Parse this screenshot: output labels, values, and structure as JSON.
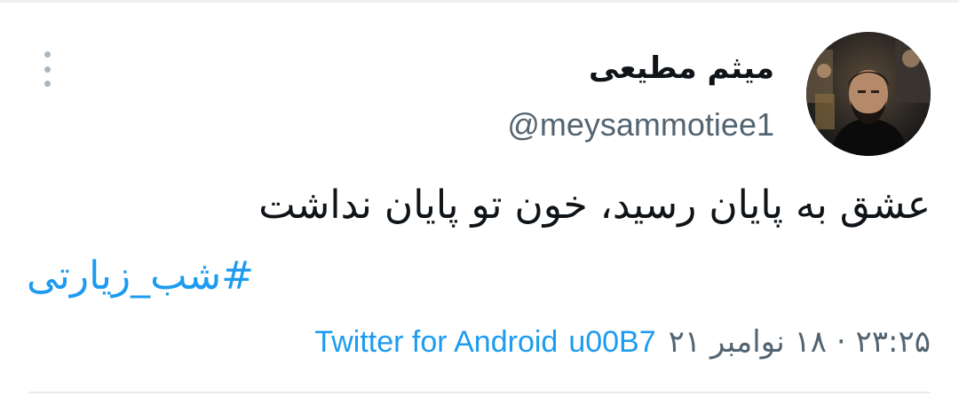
{
  "tweet": {
    "display_name": "میثم مطیعی",
    "handle": "@meysammotiee1",
    "text": "عشق به پایان رسید، خون تو پایان نداشت",
    "hashtag": "#شب_زیارتی",
    "source": "Twitter for Android",
    "separator": "u00B7",
    "timestamp": "۲۳:۲۵ · ۱۸ نوامبر ۲۱"
  },
  "icons": {
    "more": "vertical-ellipsis-icon",
    "avatar": "profile-photo"
  },
  "colors": {
    "text_primary": "#0f1419",
    "text_secondary": "#536471",
    "link": "#1d9bf0",
    "menu_dots": "#a9b6c0"
  }
}
